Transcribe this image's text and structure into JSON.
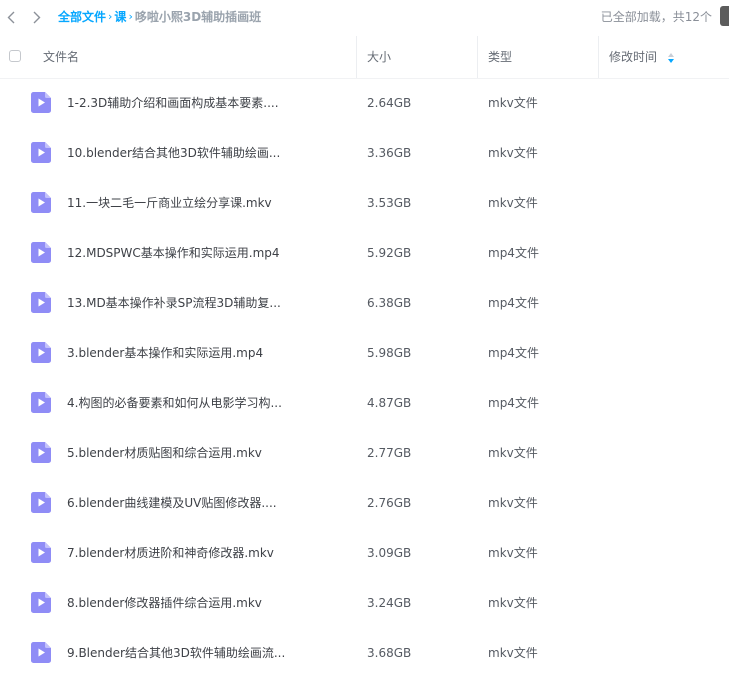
{
  "breadcrumb": {
    "items": [
      "全部文件",
      "课"
    ],
    "current": "哆啦小熙3D辅助插画班",
    "separator": "›"
  },
  "status_text": "已全部加载，共12个",
  "columns": {
    "name": "文件名",
    "size": "大小",
    "type": "类型",
    "modified": "修改时间"
  },
  "colors": {
    "accent": "#06a7ff",
    "video_icon": "#8f8cf6"
  },
  "icons": {
    "back": "chevron-left-icon",
    "forward": "chevron-right-icon",
    "file": "video-file-icon",
    "sort": "sort-icon"
  },
  "files": [
    {
      "name": "1-2.3D辅助介绍和画面构成基本要素....",
      "size": "2.64GB",
      "type": "mkv文件"
    },
    {
      "name": "10.blender结合其他3D软件辅助绘画...",
      "size": "3.36GB",
      "type": "mkv文件"
    },
    {
      "name": "11.一块二毛一斤商业立绘分享课.mkv",
      "size": "3.53GB",
      "type": "mkv文件"
    },
    {
      "name": "12.MDSPWC基本操作和实际运用.mp4",
      "size": "5.92GB",
      "type": "mp4文件"
    },
    {
      "name": "13.MD基本操作补录SP流程3D辅助复...",
      "size": "6.38GB",
      "type": "mp4文件"
    },
    {
      "name": "3.blender基本操作和实际运用.mp4",
      "size": "5.98GB",
      "type": "mp4文件"
    },
    {
      "name": "4.构图的必备要素和如何从电影学习构...",
      "size": "4.87GB",
      "type": "mp4文件"
    },
    {
      "name": "5.blender材质贴图和综合运用.mkv",
      "size": "2.77GB",
      "type": "mkv文件"
    },
    {
      "name": "6.blender曲线建模及UV贴图修改器....",
      "size": "2.76GB",
      "type": "mkv文件"
    },
    {
      "name": "7.blender材质进阶和神奇修改器.mkv",
      "size": "3.09GB",
      "type": "mkv文件"
    },
    {
      "name": "8.blender修改器插件综合运用.mkv",
      "size": "3.24GB",
      "type": "mkv文件"
    },
    {
      "name": "9.Blender结合其他3D软件辅助绘画流...",
      "size": "3.68GB",
      "type": "mkv文件"
    }
  ]
}
